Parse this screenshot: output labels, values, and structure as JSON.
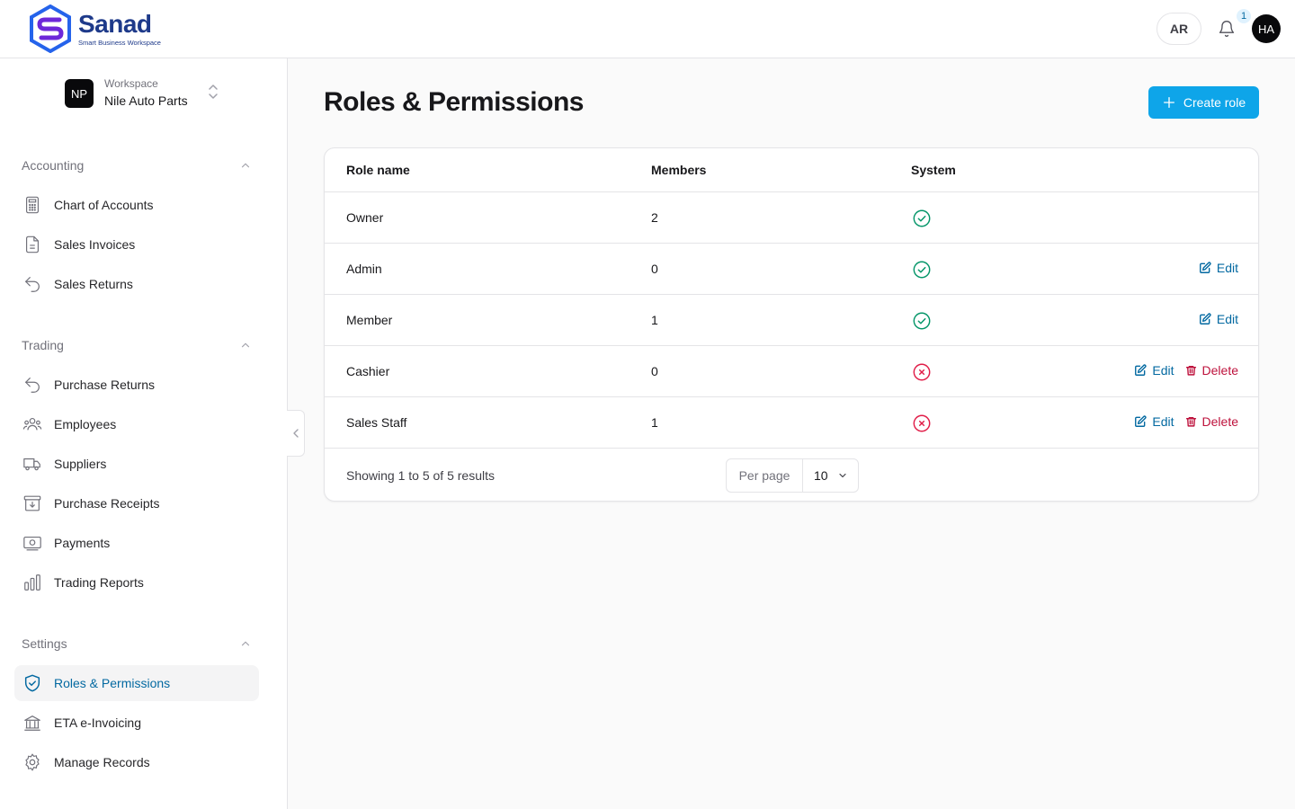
{
  "brand": {
    "name": "Sanad",
    "tagline": "Smart Business Workspace",
    "accent": "#0ea5e9"
  },
  "header": {
    "lang_label": "AR",
    "notification_count": "1",
    "avatar_initials": "HA"
  },
  "workspace": {
    "badge": "NP",
    "label": "Workspace",
    "name": "Nile Auto Parts"
  },
  "sidebar": {
    "sections": [
      {
        "title": "Accounting",
        "items": [
          {
            "label": "Chart of Accounts",
            "icon": "calculator-icon"
          },
          {
            "label": "Sales Invoices",
            "icon": "document-icon"
          },
          {
            "label": "Sales Returns",
            "icon": "return-arrow-icon"
          }
        ]
      },
      {
        "title": "Trading",
        "items": [
          {
            "label": "Purchase Returns",
            "icon": "return-arrow-icon"
          },
          {
            "label": "Employees",
            "icon": "users-icon"
          },
          {
            "label": "Suppliers",
            "icon": "truck-icon"
          },
          {
            "label": "Purchase Receipts",
            "icon": "archive-download-icon"
          },
          {
            "label": "Payments",
            "icon": "banknote-icon"
          },
          {
            "label": "Trading Reports",
            "icon": "bar-chart-icon"
          }
        ]
      },
      {
        "title": "Settings",
        "items": [
          {
            "label": "Roles & Permissions",
            "icon": "shield-check-icon",
            "active": true
          },
          {
            "label": "ETA e-Invoicing",
            "icon": "bank-icon"
          },
          {
            "label": "Manage Records",
            "icon": "gear-icon"
          }
        ]
      }
    ]
  },
  "page": {
    "title": "Roles & Permissions",
    "create_label": "Create role"
  },
  "table": {
    "columns": [
      "Role name",
      "Members",
      "System"
    ],
    "rows": [
      {
        "name": "Owner",
        "members": "2",
        "system": true,
        "edit": "",
        "delete": ""
      },
      {
        "name": "Admin",
        "members": "0",
        "system": true,
        "edit": "Edit",
        "delete": ""
      },
      {
        "name": "Member",
        "members": "1",
        "system": true,
        "edit": "Edit",
        "delete": ""
      },
      {
        "name": "Cashier",
        "members": "0",
        "system": false,
        "edit": "Edit",
        "delete": "Delete"
      },
      {
        "name": "Sales Staff",
        "members": "1",
        "system": false,
        "edit": "Edit",
        "delete": "Delete"
      }
    ],
    "status_colors": {
      "yes": "#059669",
      "no": "#e11d48"
    }
  },
  "pagination": {
    "summary": "Showing 1 to 5 of 5 results",
    "per_page_label": "Per page",
    "per_page_value": "10"
  }
}
